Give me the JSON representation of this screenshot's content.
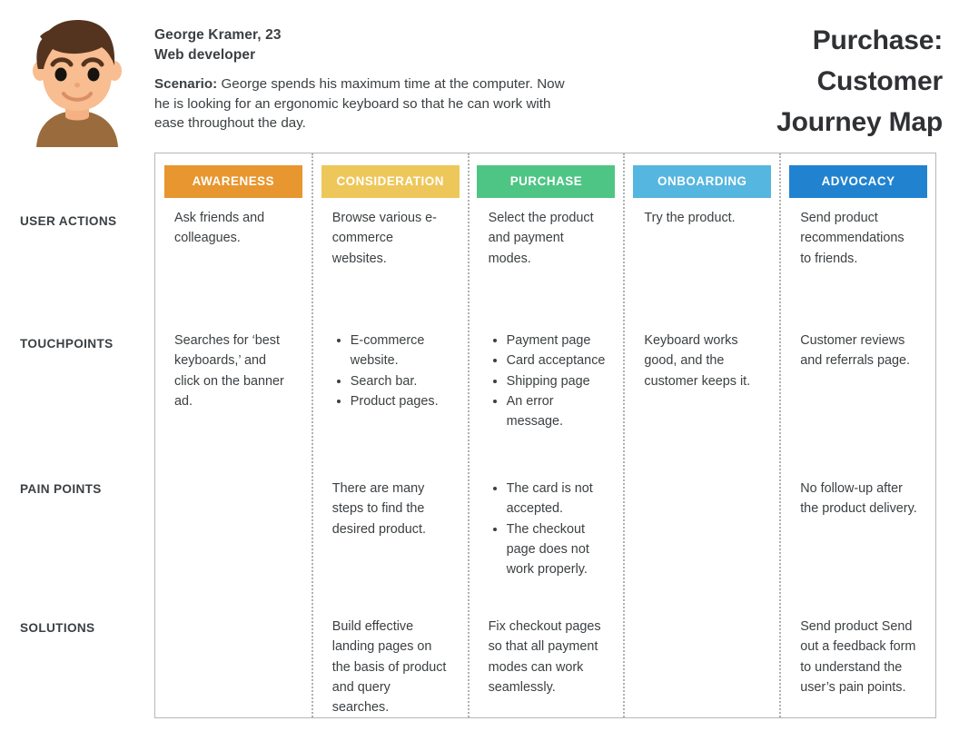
{
  "header": {
    "persona": {
      "name": "George Kramer, 23",
      "role": "Web developer",
      "scenario_label": "Scenario:",
      "scenario_text": " George spends his maximum time at the computer. Now he is looking for an ergonomic keyboard so that he can work with ease throughout the day."
    },
    "title_line1": "Purchase:",
    "title_line2": "Customer",
    "title_line3": "Journey Map",
    "avatar_icon": "user-avatar-illustration"
  },
  "map": {
    "row_labels": [
      "USER ACTIONS",
      "TOUCHPOINTS",
      "PAIN POINTS",
      "SOLUTIONS"
    ],
    "stages": [
      {
        "label": "AWARENESS",
        "color": "#e8962f"
      },
      {
        "label": "CONSIDERATION",
        "color": "#eec75a"
      },
      {
        "label": "PURCHASE",
        "color": "#4ec584"
      },
      {
        "label": "ONBOARDING",
        "color": "#55b6e0"
      },
      {
        "label": "ADVOCACY",
        "color": "#2183d0"
      }
    ],
    "cells": {
      "user_actions": [
        {
          "type": "text",
          "text": "Ask friends and colleagues."
        },
        {
          "type": "text",
          "text": "Browse various e-commerce websites."
        },
        {
          "type": "text",
          "text": "Select the product and payment modes."
        },
        {
          "type": "text",
          "text": "Try the product."
        },
        {
          "type": "text",
          "text": "Send product recommendations to friends."
        }
      ],
      "touchpoints": [
        {
          "type": "text",
          "text": "Searches for ‘best keyboards,’ and click on the banner ad."
        },
        {
          "type": "list",
          "items": [
            "E-commerce website.",
            "Search bar.",
            "Product pages."
          ]
        },
        {
          "type": "list",
          "items": [
            "Payment page",
            "Card acceptance",
            "Shipping page",
            "An error message."
          ]
        },
        {
          "type": "text",
          "text": "Keyboard works good, and the customer keeps it."
        },
        {
          "type": "text",
          "text": "Customer reviews and referrals page."
        }
      ],
      "pain_points": [
        {
          "type": "text",
          "text": ""
        },
        {
          "type": "text",
          "text": "There are many steps to find the desired product."
        },
        {
          "type": "list",
          "items": [
            "The card is not accepted.",
            "The checkout page does not work properly."
          ]
        },
        {
          "type": "text",
          "text": ""
        },
        {
          "type": "text",
          "text": "No follow-up after the product delivery."
        }
      ],
      "solutions": [
        {
          "type": "text",
          "text": ""
        },
        {
          "type": "text",
          "text": "Build effective landing pages on the basis of product and query searches."
        },
        {
          "type": "text",
          "text": "Fix checkout pages so that all payment modes can work seamlessly."
        },
        {
          "type": "text",
          "text": ""
        },
        {
          "type": "text",
          "text": "Send product Send out a feedback form to understand the user’s pain points."
        }
      ]
    }
  },
  "colors": {
    "text": "#3c4043",
    "border": "#b7b7b7",
    "separator": "#b0b0b0"
  }
}
